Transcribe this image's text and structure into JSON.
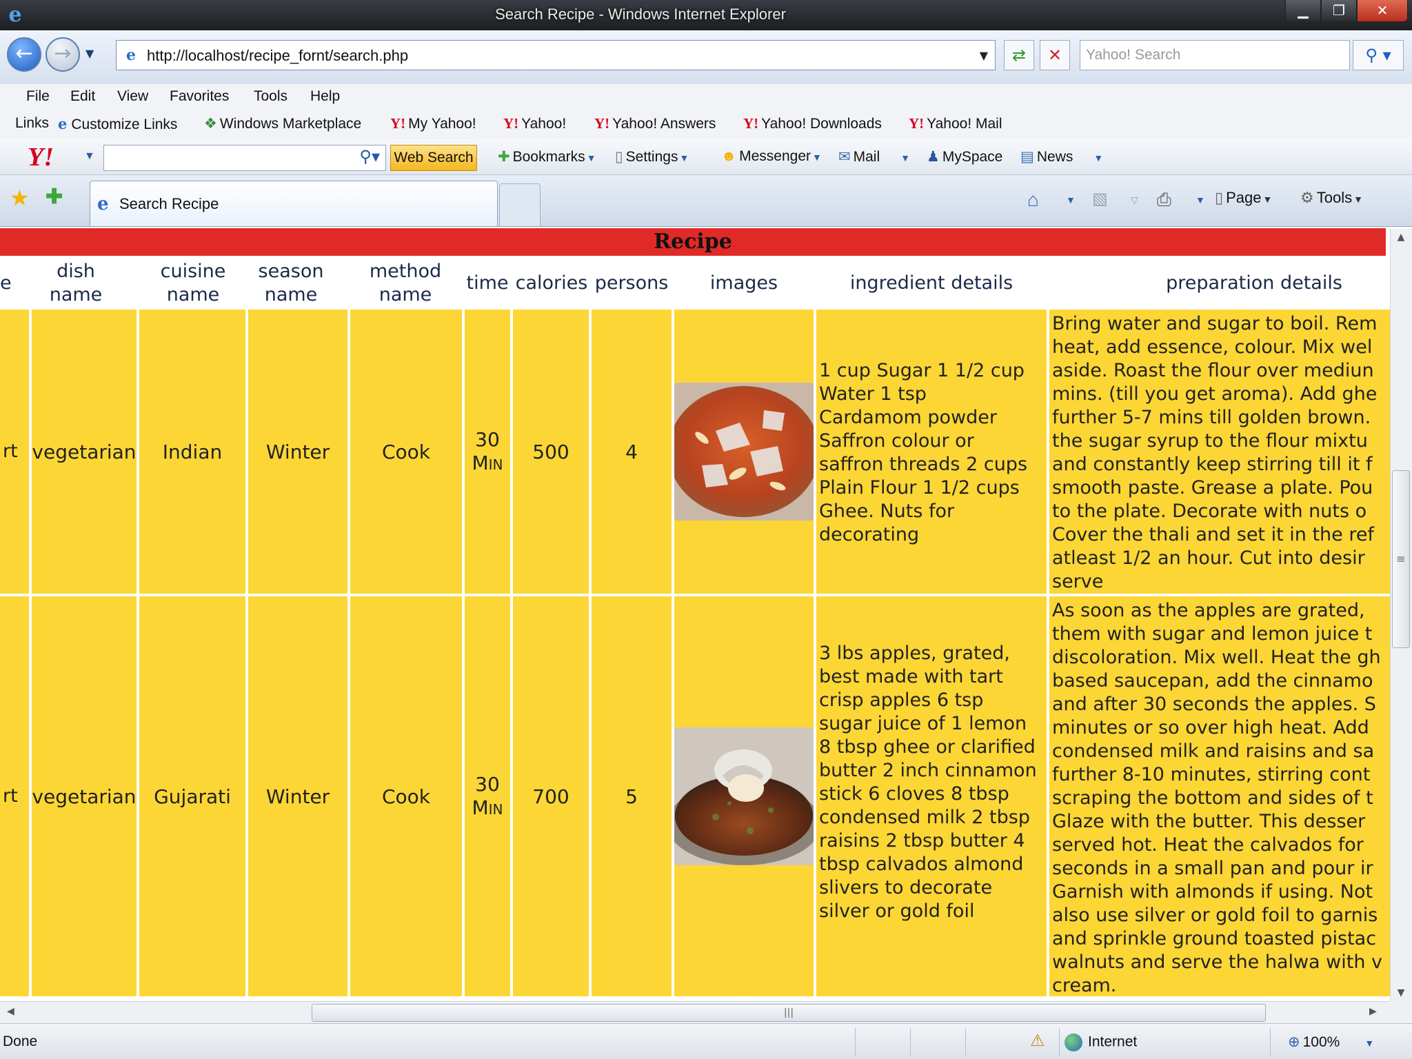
{
  "window": {
    "title": "Search Recipe - Windows Internet Explorer",
    "minimize": "▁",
    "restore": "❐",
    "close": "✕"
  },
  "address": {
    "url": "http://localhost/recipe_fornt/search.php",
    "search_placeholder": "Yahoo! Search"
  },
  "menu": [
    "File",
    "Edit",
    "View",
    "Favorites",
    "Tools",
    "Help"
  ],
  "links": {
    "label": "Links",
    "items": [
      "Customize Links",
      "Windows Marketplace",
      "My Yahoo!",
      "Yahoo!",
      "Yahoo! Answers",
      "Yahoo! Downloads",
      "Yahoo! Mail"
    ]
  },
  "yahoo_toolbar": {
    "web_search": "Web Search",
    "bookmarks": "Bookmarks",
    "settings": "Settings",
    "messenger": "Messenger",
    "mail": "Mail",
    "myspace": "MySpace",
    "news": "News"
  },
  "tabs": {
    "active": "Search Recipe",
    "commands": {
      "page": "Page",
      "tools": "Tools"
    }
  },
  "table": {
    "title": "Recipe",
    "headers": {
      "partial": "e",
      "dish": "dish name",
      "cuisine": "cuisine name",
      "season": "season name",
      "method": "method name",
      "time": "time",
      "calories": "calories",
      "persons": "persons",
      "images": "images",
      "ingredients": "ingredient details",
      "preparation": "preparation details"
    },
    "rows": [
      {
        "partial": "rt",
        "dish": "vegetarian",
        "cuisine": "Indian",
        "season": "Winter",
        "method": "Cook",
        "time": "30 Min",
        "calories": "500",
        "persons": "4",
        "ingredients": [
          "1 cup Sugar 1 1/2 cup",
          "Water 1 tsp",
          "Cardamom powder",
          "Saffron colour or",
          "saffron threads 2 cups",
          "Plain Flour 1 1/2 cups",
          "Ghee. Nuts for",
          "decorating"
        ],
        "preparation": [
          "Bring water and sugar to boil. Rem",
          "heat, add essence, colour. Mix wel",
          "aside. Roast the flour over mediun",
          "mins. (till you get aroma). Add ghe",
          "further 5-7 mins till golden brown.",
          "the sugar syrup to the flour mixtu",
          "and constantly keep stirring till it f",
          "smooth paste. Grease a plate. Pou",
          "to the plate. Decorate with nuts o",
          "Cover the thali and set it in the ref",
          "atleast 1/2 an hour. Cut into desir",
          "serve"
        ]
      },
      {
        "partial": "rt",
        "dish": "vegetarian",
        "cuisine": "Gujarati",
        "season": "Winter",
        "method": "Cook",
        "time": "30 Min",
        "calories": "700",
        "persons": "5",
        "ingredients": [
          "3 lbs apples, grated,",
          "best made with tart",
          "crisp apples 6 tsp",
          "sugar juice of 1 lemon",
          "8 tbsp ghee or clarified",
          "butter 2 inch cinnamon",
          "stick 6 cloves 8 tbsp",
          "condensed milk 2 tbsp",
          "raisins 2 tbsp butter 4",
          "tbsp calvados almond",
          "slivers to decorate",
          "silver or gold foil"
        ],
        "preparation": [
          "As soon as the apples are grated,",
          "them with sugar and lemon juice t",
          "discoloration. Mix well. Heat the gh",
          "based saucepan, add the cinnamo",
          "and after 30 seconds the apples. S",
          "minutes or so over high heat. Add",
          "condensed milk and raisins and sa",
          "further 8-10 minutes, stirring cont",
          "scraping the bottom and sides of t",
          "Glaze with the butter. This desser",
          "served hot. Heat the calvados for",
          "seconds in a small pan and pour ir",
          "Garnish with almonds if using. Not",
          "also use silver or gold foil to garnis",
          "and sprinkle ground toasted pistac",
          "walnuts and serve the halwa with v",
          "cream."
        ]
      }
    ]
  },
  "status": {
    "text": "Done",
    "zone": "Internet",
    "zoom": "100%"
  },
  "colors": {
    "header_red": "#e12a27",
    "cell_yellow": "#fcd635"
  }
}
